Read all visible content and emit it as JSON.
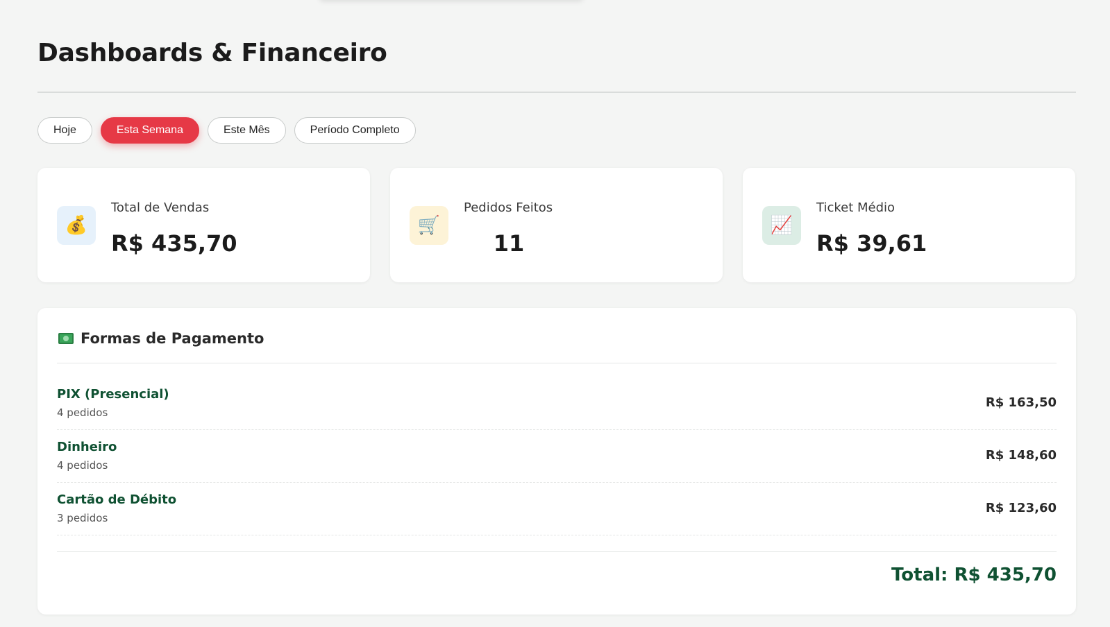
{
  "header": {
    "title": "Dashboards & Financeiro"
  },
  "filters": [
    {
      "label": "Hoje",
      "active": false
    },
    {
      "label": "Esta Semana",
      "active": true
    },
    {
      "label": "Este Mês",
      "active": false
    },
    {
      "label": "Período Completo",
      "active": false
    }
  ],
  "stats": {
    "sales": {
      "icon": "money-bag-icon",
      "icon_char": "💰",
      "label": "Total de Vendas",
      "value": "R$ 435,70",
      "icon_bg": "#e6f1fb"
    },
    "orders": {
      "icon": "shopping-cart-icon",
      "icon_char": "🛒",
      "label": "Pedidos Feitos",
      "value": "11",
      "icon_bg": "#fdf3d7"
    },
    "ticket": {
      "icon": "chart-increasing-icon",
      "icon_char": "📈",
      "label": "Ticket Médio",
      "value": "R$ 39,61",
      "icon_bg": "#dcede5"
    }
  },
  "payments": {
    "icon": "dollar-banknote-icon",
    "title": "Formas de Pagamento",
    "rows": [
      {
        "name": "PIX (Presencial)",
        "count": "4 pedidos",
        "amount": "R$ 163,50"
      },
      {
        "name": "Dinheiro",
        "count": "4 pedidos",
        "amount": "R$ 148,60"
      },
      {
        "name": "Cartão de Débito",
        "count": "3 pedidos",
        "amount": "R$ 123,60"
      }
    ],
    "total": "Total: R$ 435,70"
  },
  "colors": {
    "accent": "#e63946",
    "brand_green": "#0f5132",
    "background": "#f4f5f4"
  }
}
